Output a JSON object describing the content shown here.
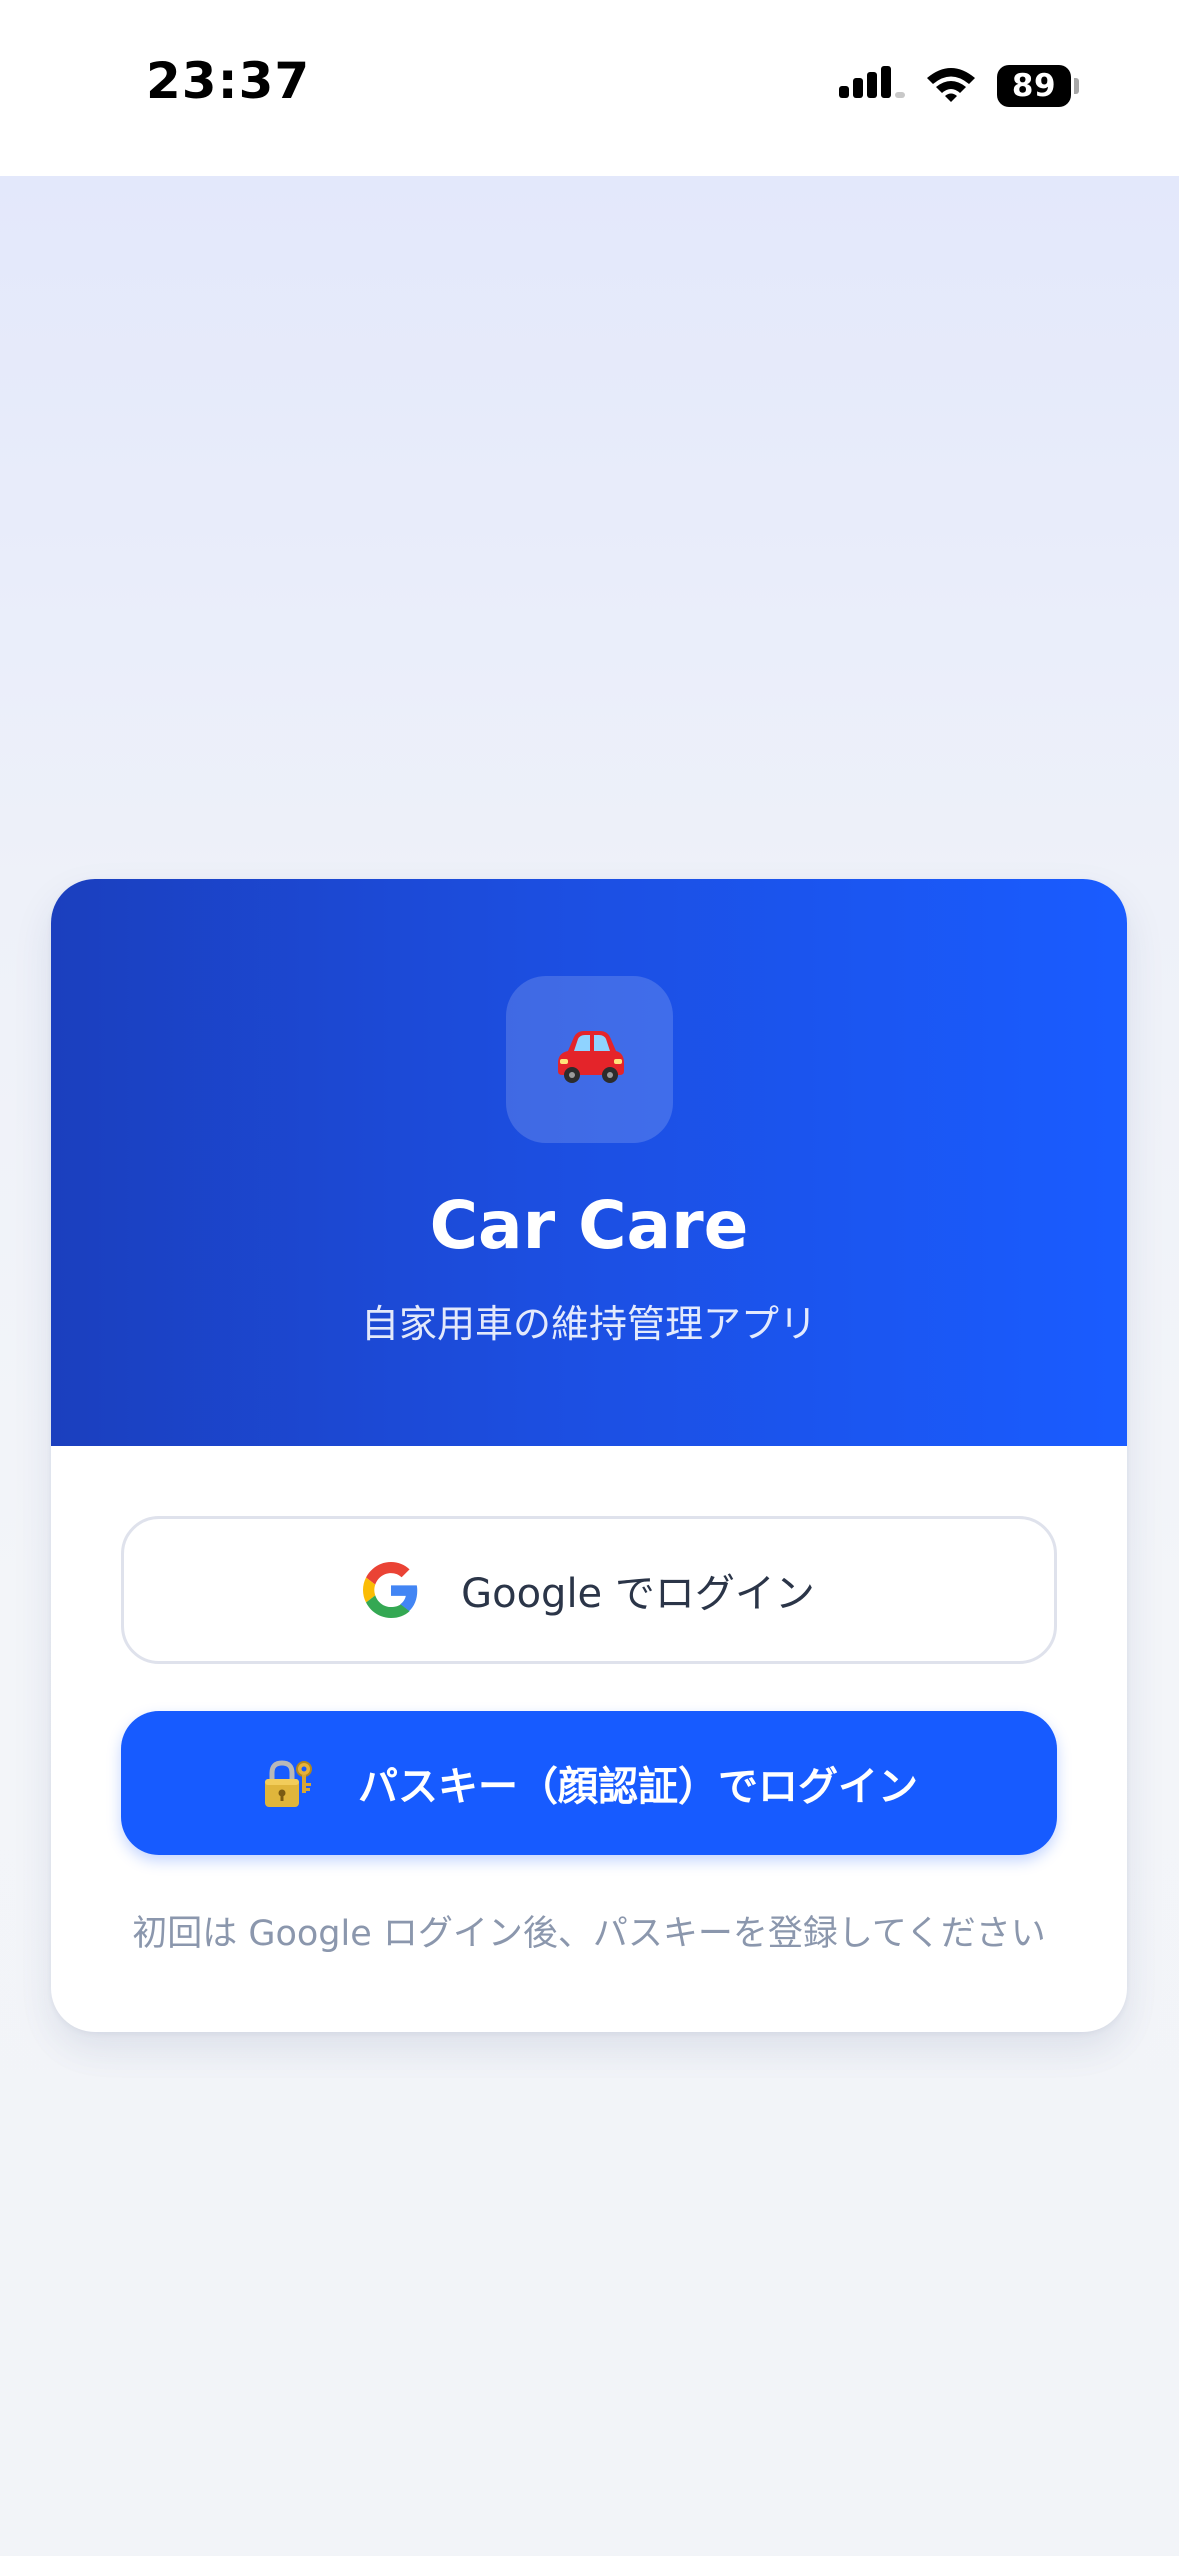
{
  "status_bar": {
    "time": "23:37",
    "battery": "89",
    "icons": [
      "cellular-signal-icon",
      "wifi-icon",
      "battery-icon"
    ]
  },
  "app": {
    "icon": "car-icon",
    "title": "Car Care",
    "subtitle": "自家用車の維持管理アプリ"
  },
  "login": {
    "google_label": "Google でログイン",
    "google_icon": "google-g-icon",
    "passkey_label": "パスキー（顔認証）でログイン",
    "passkey_icon": "lock-key-icon",
    "hint": "初回は Google ログイン後、パスキーを登録してください"
  },
  "colors": {
    "header_gradient_start": "#1b3fbe",
    "header_gradient_end": "#1a5cff",
    "primary_button": "#175bff",
    "hint_text": "#8b97ad",
    "google_button_text": "#2b3548"
  }
}
